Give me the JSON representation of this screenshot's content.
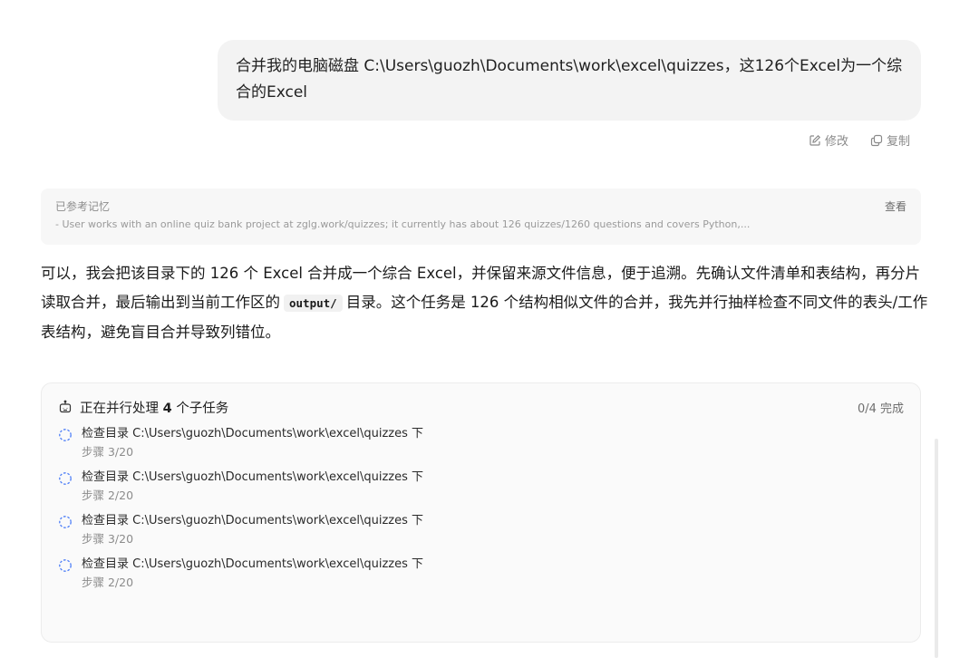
{
  "user_message": {
    "text": "合并我的电脑磁盘 C:\\Users\\guozh\\Documents\\work\\excel\\quizzes，这126个Excel为一个综合的Excel",
    "actions": [
      {
        "icon": "edit-icon",
        "label": "修改"
      },
      {
        "icon": "copy-icon",
        "label": "复制"
      }
    ]
  },
  "memory": {
    "title": "已参考记忆",
    "view_label": "查看",
    "content": "- User works with an online quiz bank project at zglg.work/quizzes; it currently has about 126 quizzes/1260 questions and covers Python,..."
  },
  "answer": {
    "part1": "可以，我会把该目录下的 126 个 Excel 合并成一个综合 Excel，并保留来源文件信息，便于追溯。先确认文件清单和表结构，再分片读取合并，最后输出到当前工作区的",
    "code": "output/",
    "part2": "目录。这个任务是 126 个结构相似文件的合并，我先并行抽样检查不同文件的表头/工作表结构，避免盲目合并导致列错位。"
  },
  "tasks": {
    "icon": "robot-icon",
    "title_prefix": "正在并行处理",
    "title_count": "4",
    "title_suffix": "个子任务",
    "status": "0/4 完成",
    "items": [
      {
        "label": "检查目录 C:\\Users\\guozh\\Documents\\work\\excel\\quizzes 下",
        "step": "步骤 3/20"
      },
      {
        "label": "检查目录 C:\\Users\\guozh\\Documents\\work\\excel\\quizzes 下",
        "step": "步骤 2/20"
      },
      {
        "label": "检查目录 C:\\Users\\guozh\\Documents\\work\\excel\\quizzes 下",
        "step": "步骤 3/20"
      },
      {
        "label": "检查目录 C:\\Users\\guozh\\Documents\\work\\excel\\quizzes 下",
        "step": "步骤 2/20"
      }
    ]
  },
  "colors": {
    "spinner": "#4a7cf7",
    "bubble_bg": "#f3f3f3"
  }
}
